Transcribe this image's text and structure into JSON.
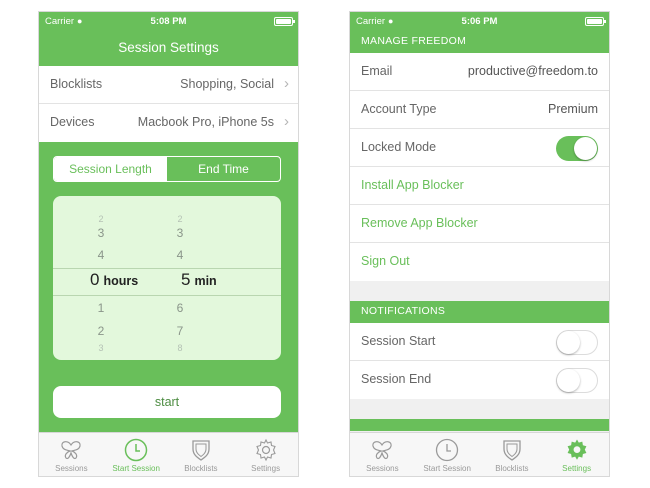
{
  "left": {
    "status": {
      "carrier": "Carrier",
      "time": "5:08 PM"
    },
    "title": "Session Settings",
    "rows": [
      {
        "label": "Blocklists",
        "value": "Shopping, Social"
      },
      {
        "label": "Devices",
        "value": "Macbook Pro, iPhone 5s"
      }
    ],
    "segment": {
      "length": "Session Length",
      "end": "End Time",
      "selected": "Session Length"
    },
    "picker": {
      "hours_col": [
        "2",
        "3",
        "4",
        "0",
        "1",
        "2",
        "3"
      ],
      "mins_col": [
        "2",
        "3",
        "4",
        "5",
        "6",
        "7",
        "8"
      ],
      "hours_value": "0",
      "hours_unit": "hours",
      "mins_value": "5",
      "mins_unit": "min"
    },
    "start_label": "start",
    "tabs": [
      {
        "label": "Sessions",
        "icon": "butterfly-icon"
      },
      {
        "label": "Start Session",
        "icon": "clock-icon"
      },
      {
        "label": "Blocklists",
        "icon": "shield-icon"
      },
      {
        "label": "Settings",
        "icon": "gear-icon"
      }
    ],
    "active_tab": "Start Session"
  },
  "right": {
    "status": {
      "carrier": "Carrier",
      "time": "5:06 PM"
    },
    "manage_header": "MANAGE FREEDOM",
    "email_label": "Email",
    "email_value": "productive@freedom.to",
    "account_label": "Account Type",
    "account_value": "Premium",
    "locked_label": "Locked Mode",
    "locked_on": true,
    "install_label": "Install App Blocker",
    "remove_label": "Remove App Blocker",
    "signout_label": "Sign Out",
    "notifications_header": "NOTIFICATIONS",
    "session_start_label": "Session Start",
    "session_start_on": false,
    "session_end_label": "Session End",
    "session_end_on": false,
    "tabs": [
      {
        "label": "Sessions",
        "icon": "butterfly-icon"
      },
      {
        "label": "Start Session",
        "icon": "clock-icon"
      },
      {
        "label": "Blocklists",
        "icon": "shield-icon"
      },
      {
        "label": "Settings",
        "icon": "gear-icon"
      }
    ],
    "active_tab": "Settings"
  },
  "colors": {
    "brand_green": "#69bf5a",
    "picker_bg": "#e3f8dc",
    "tab_inactive": "#9a9a9a"
  }
}
